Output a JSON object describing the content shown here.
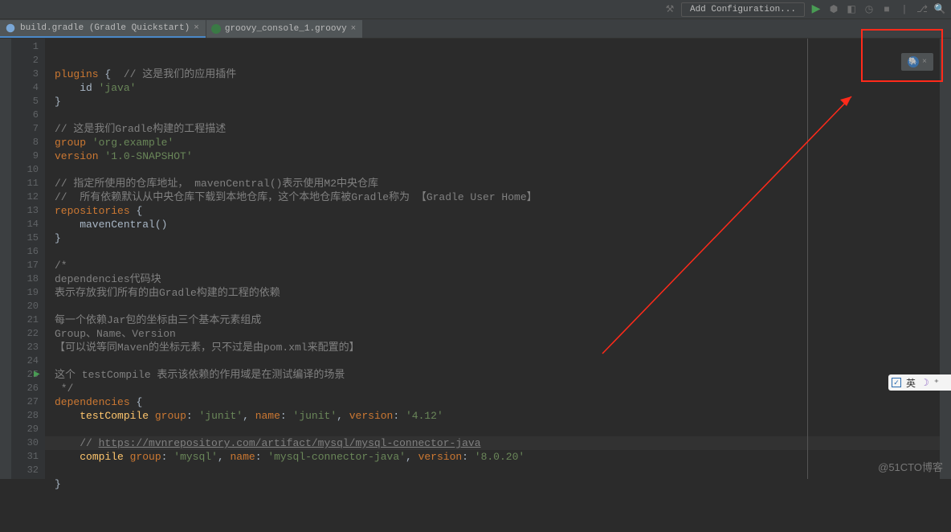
{
  "toolbar": {
    "run_config": "Add Configuration..."
  },
  "tabs": [
    {
      "label": "build.gradle (Gradle Quickstart)",
      "active": true
    },
    {
      "label": "groovy_console_1.groovy",
      "active": false
    }
  ],
  "watermark": "@51CTO博客",
  "ime": {
    "lang": "英"
  },
  "code_lines": [
    {
      "n": 1,
      "fold": " ",
      "html": "<span class='kw'>plugins</span> <span class='braces'>{</span>  <span class='cm'>// 这是我们的应用插件</span>"
    },
    {
      "n": 2,
      "fold": " ",
      "html": "    id <span class='str'>'java'</span>"
    },
    {
      "n": 3,
      "fold": "⌄",
      "html": "<span class='braces'>}</span>"
    },
    {
      "n": 4,
      "fold": " ",
      "html": ""
    },
    {
      "n": 5,
      "fold": " ",
      "html": "<span class='cm'>// 这是我们Gradle构建的工程描述</span>"
    },
    {
      "n": 6,
      "fold": " ",
      "html": "<span class='kw'>group</span> <span class='str'>'org.example'</span>"
    },
    {
      "n": 7,
      "fold": " ",
      "html": "<span class='kw'>version</span> <span class='str'>'1.0-SNAPSHOT'</span>"
    },
    {
      "n": 8,
      "fold": " ",
      "html": ""
    },
    {
      "n": 9,
      "fold": " ",
      "html": "<span class='cm'>// 指定所使用的仓库地址， mavenCentral()表示使用M2中央仓库</span>"
    },
    {
      "n": 10,
      "fold": " ",
      "html": "<span class='cm'>//  所有依赖默认从中央仓库下载到本地仓库，这个本地仓库被Gradle称为 【Gradle User Home】</span>"
    },
    {
      "n": 11,
      "fold": "⌄",
      "html": "<span class='kw'>repositories</span> <span class='braces'>{</span>"
    },
    {
      "n": 12,
      "fold": " ",
      "html": "    mavenCentral()"
    },
    {
      "n": 13,
      "fold": "⌃",
      "html": "<span class='braces'>}</span>"
    },
    {
      "n": 14,
      "fold": " ",
      "html": ""
    },
    {
      "n": 15,
      "fold": "⌄",
      "html": "<span class='cm'>/*</span>"
    },
    {
      "n": 16,
      "fold": " ",
      "html": "<span class='cm'>dependencies代码块</span>"
    },
    {
      "n": 17,
      "fold": " ",
      "html": "<span class='cm'>表示存放我们所有的由Gradle构建的工程的依赖</span>"
    },
    {
      "n": 18,
      "fold": " ",
      "html": ""
    },
    {
      "n": 19,
      "fold": " ",
      "html": "<span class='cm'>每一个依赖Jar包的坐标由三个基本元素组成</span>"
    },
    {
      "n": 20,
      "fold": " ",
      "html": "<span class='cm'>Group、Name、Version</span>"
    },
    {
      "n": 21,
      "fold": " ",
      "html": "<span class='cm'>【可以说等同Maven的坐标元素，只不过是由pom.xml来配置的】</span>"
    },
    {
      "n": 22,
      "fold": " ",
      "html": ""
    },
    {
      "n": 23,
      "fold": " ",
      "html": "<span class='cm'>这个 testCompile 表示该依赖的作用域是在测试编译的场景</span>"
    },
    {
      "n": 24,
      "fold": "⌃",
      "html": "<span class='cm'> */</span>"
    },
    {
      "n": 25,
      "fold": "⌄",
      "html": "<span class='kw'>dependencies</span> <span class='braces'>{</span>",
      "run": true
    },
    {
      "n": 26,
      "fold": " ",
      "html": "    <span class='fn'>testCompile</span> <span class='kw'>group</span>: <span class='str'>'junit'</span>, <span class='kw'>name</span>: <span class='str'>'junit'</span>, <span class='kw'>version</span>: <span class='str'>'4.12'</span>"
    },
    {
      "n": 27,
      "fold": " ",
      "html": ""
    },
    {
      "n": 28,
      "fold": " ",
      "html": "    <span class='cm'>// </span><span class='url'>https://mvnrepository.com/artifact/mysql/mysql-connector-java</span>"
    },
    {
      "n": 29,
      "fold": " ",
      "html": "    <span class='fn'>compile</span> <span class='kw'>group</span>: <span class='str'>'mysql'</span>, <span class='kw'>name</span>: <span class='str'>'mysql-connector-java'</span>, <span class='kw'>version</span>: <span class='str'>'8.0.20'</span>"
    },
    {
      "n": 30,
      "fold": " ",
      "html": "",
      "highlight": true
    },
    {
      "n": 31,
      "fold": "⌃",
      "html": "<span class='braces'>}</span>"
    },
    {
      "n": 32,
      "fold": " ",
      "html": ""
    }
  ]
}
